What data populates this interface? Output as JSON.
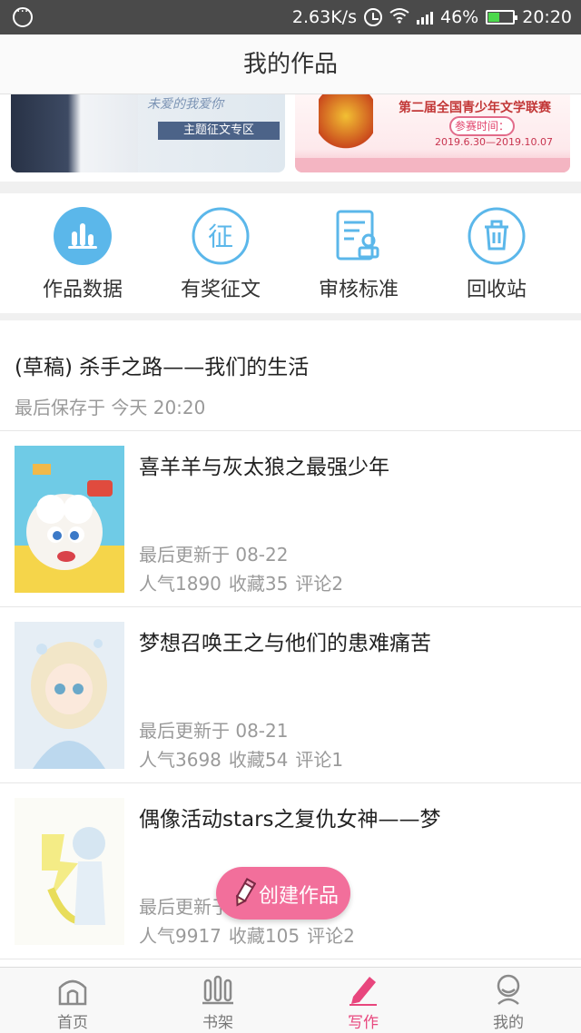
{
  "status_bar": {
    "speed": "2.63K/s",
    "battery": "46%",
    "battery_level": 0.46,
    "time": "20:20"
  },
  "header": {
    "title": "我的作品"
  },
  "banners": {
    "left": {
      "tag": "主题征文专区",
      "headline": "未爱的我爱你"
    },
    "right": {
      "headline": "第二届全国青少年文学联赛",
      "badge": "参赛时间：",
      "dates": "2019.6.30—2019.10.07"
    }
  },
  "actions": [
    {
      "label": "作品数据",
      "icon": "bar-chart-icon"
    },
    {
      "label": "有奖征文",
      "icon": "contest-icon"
    },
    {
      "label": "审核标准",
      "icon": "review-standard-icon"
    },
    {
      "label": "回收站",
      "icon": "trash-icon"
    }
  ],
  "draft": {
    "title": "(草稿) 杀手之路——我们的生活",
    "saved": "最后保存于 今天 20:20"
  },
  "works": [
    {
      "title": "喜羊羊与灰太狼之最强少年",
      "updated": "最后更新于 08-22",
      "popularity": "人气1890",
      "favorites": "收藏35",
      "comments": "评论2"
    },
    {
      "title": "梦想召唤王之与他们的患难痛苦",
      "updated": "最后更新于 08-21",
      "popularity": "人气3698",
      "favorites": "收藏54",
      "comments": "评论1"
    },
    {
      "title": "偶像活动stars之复仇女神——梦",
      "updated": "最后更新于",
      "popularity": "人气9917",
      "favorites": "收藏105",
      "comments": "评论2"
    }
  ],
  "fab": {
    "label": "创建作品"
  },
  "nav": [
    {
      "label": "首页",
      "icon": "home-icon"
    },
    {
      "label": "书架",
      "icon": "bookshelf-icon"
    },
    {
      "label": "写作",
      "icon": "pen-icon"
    },
    {
      "label": "我的",
      "icon": "profile-icon"
    }
  ],
  "colors": {
    "accent": "#e8467d",
    "fab": "#f26f9b",
    "icon_blue": "#5bb7ea"
  }
}
